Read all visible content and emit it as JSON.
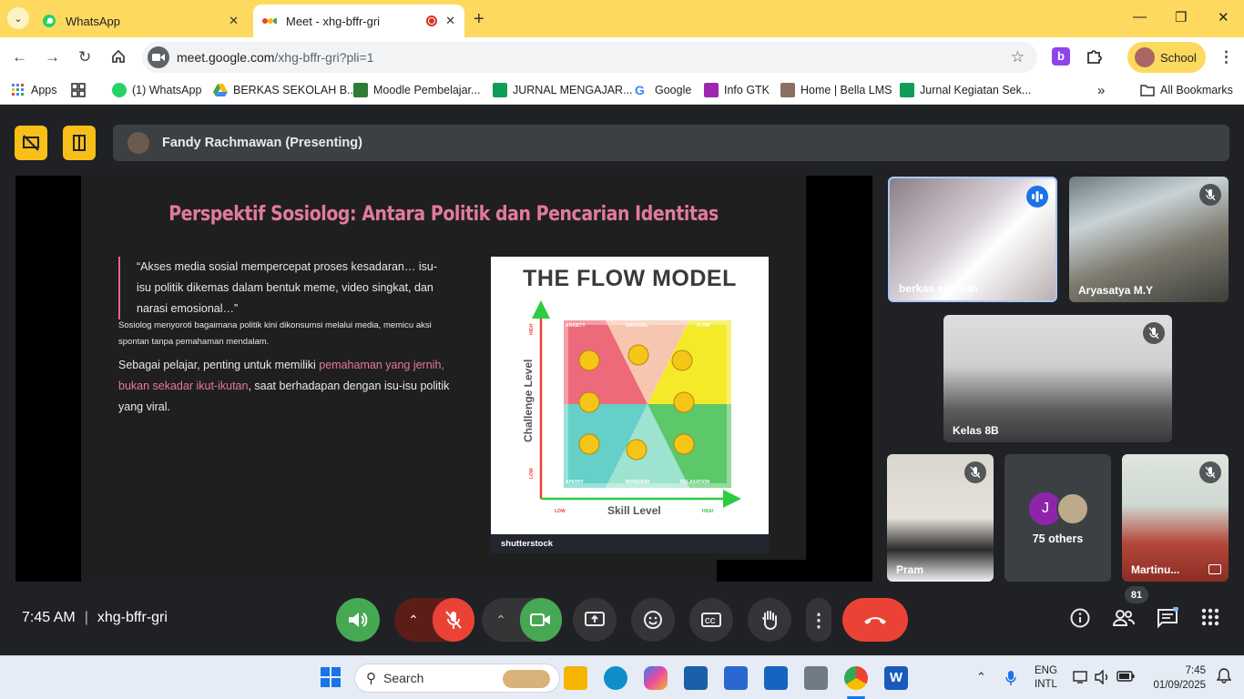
{
  "browser": {
    "tabs": [
      {
        "title": "WhatsApp",
        "active": false
      },
      {
        "title": "Meet - xhg-bffr-gri",
        "active": true
      }
    ],
    "url_host": "meet.google.com",
    "url_path": "/xhg-bffr-gri?pli=1",
    "profile_label": "School",
    "bookmarks": [
      {
        "label": "Apps",
        "icon": "apps-grid-icon",
        "color": "#4285f4"
      },
      {
        "label": "",
        "icon": "tab-groups-icon",
        "color": "#333333"
      },
      {
        "label": "(1) WhatsApp",
        "icon": "whatsapp-icon",
        "color": "#25d366"
      },
      {
        "label": "BERKAS SEKOLAH B...",
        "icon": "google-drive-icon",
        "color": "#fbbc04"
      },
      {
        "label": "Moodle Pembelajar...",
        "icon": "moodle-icon",
        "color": "#2e7d32"
      },
      {
        "label": "JURNAL MENGAJAR...",
        "icon": "google-sheets-icon",
        "color": "#0f9d58"
      },
      {
        "label": "Google",
        "icon": "google-icon",
        "color": "#4285f4"
      },
      {
        "label": "Info GTK",
        "icon": "gtk-icon",
        "color": "#9c27b0"
      },
      {
        "label": "Home | Bella LMS",
        "icon": "lms-icon",
        "color": "#8d6e63"
      },
      {
        "label": "Jurnal Kegiatan Sek...",
        "icon": "google-sheets-icon",
        "color": "#0f9d58"
      }
    ],
    "all_bookmarks_label": "All Bookmarks"
  },
  "meet": {
    "presenter_banner": "Fandy Rachmawan (Presenting)",
    "slide": {
      "title": "Perspektif Sosiolog: Antara Politik dan Pencarian Identitas",
      "quote": "“Akses media sosial mempercepat proses kesadaran… isu-isu politik dikemas dalam bentuk meme, video singkat, dan narasi emosional…”",
      "small_text": "Sosiolog menyoroti bagaimana politik kini dikonsumsi melalui media, memicu aksi spontan tanpa pemahaman mendalam.",
      "body_before": "Sebagai pelajar, penting untuk memiliki ",
      "body_highlight": "pemahaman yang jernih, bukan sekadar ikut-ikutan",
      "body_after": ", saat berhadapan dengan isu-isu politik yang viral.",
      "image": {
        "title": "THE FLOW MODEL",
        "y_axis": "Challenge Level",
        "x_axis": "Skill Level",
        "low_y": "LOW",
        "high_y": "HIGH",
        "low_x": "LOW",
        "high_x": "HIGH",
        "zones_top": [
          "ANXIETY",
          "AROUSAL",
          "FLOW"
        ],
        "zones_bottom": [
          "APATHY",
          "BOREDOM",
          "RELAXATION"
        ],
        "zone_left": "WORRY",
        "zone_right": "CONTROL",
        "watermark": "shutterstock"
      }
    },
    "participants": [
      {
        "name": "berkas sekolah",
        "speaking": true
      },
      {
        "name": "Aryasatya M.Y",
        "muted": true
      },
      {
        "name": "Kelas 8B",
        "muted": true
      },
      {
        "name": "Pram",
        "muted": true
      },
      {
        "name": "75 others",
        "initial": "J"
      },
      {
        "name": "Martinu...",
        "muted": true
      }
    ],
    "time": "7:45 AM",
    "meeting_code": "xhg-bffr-gri",
    "people_count": "81",
    "colors": {
      "leave": "#ea4335",
      "audio": "#46a853",
      "mic_off": "#ea4335",
      "accent": "#f9bf19"
    }
  },
  "taskbar": {
    "search_placeholder": "Search",
    "lang_top": "ENG",
    "lang_bottom": "INTL",
    "time": "7:45",
    "date": "01/09/2025"
  }
}
